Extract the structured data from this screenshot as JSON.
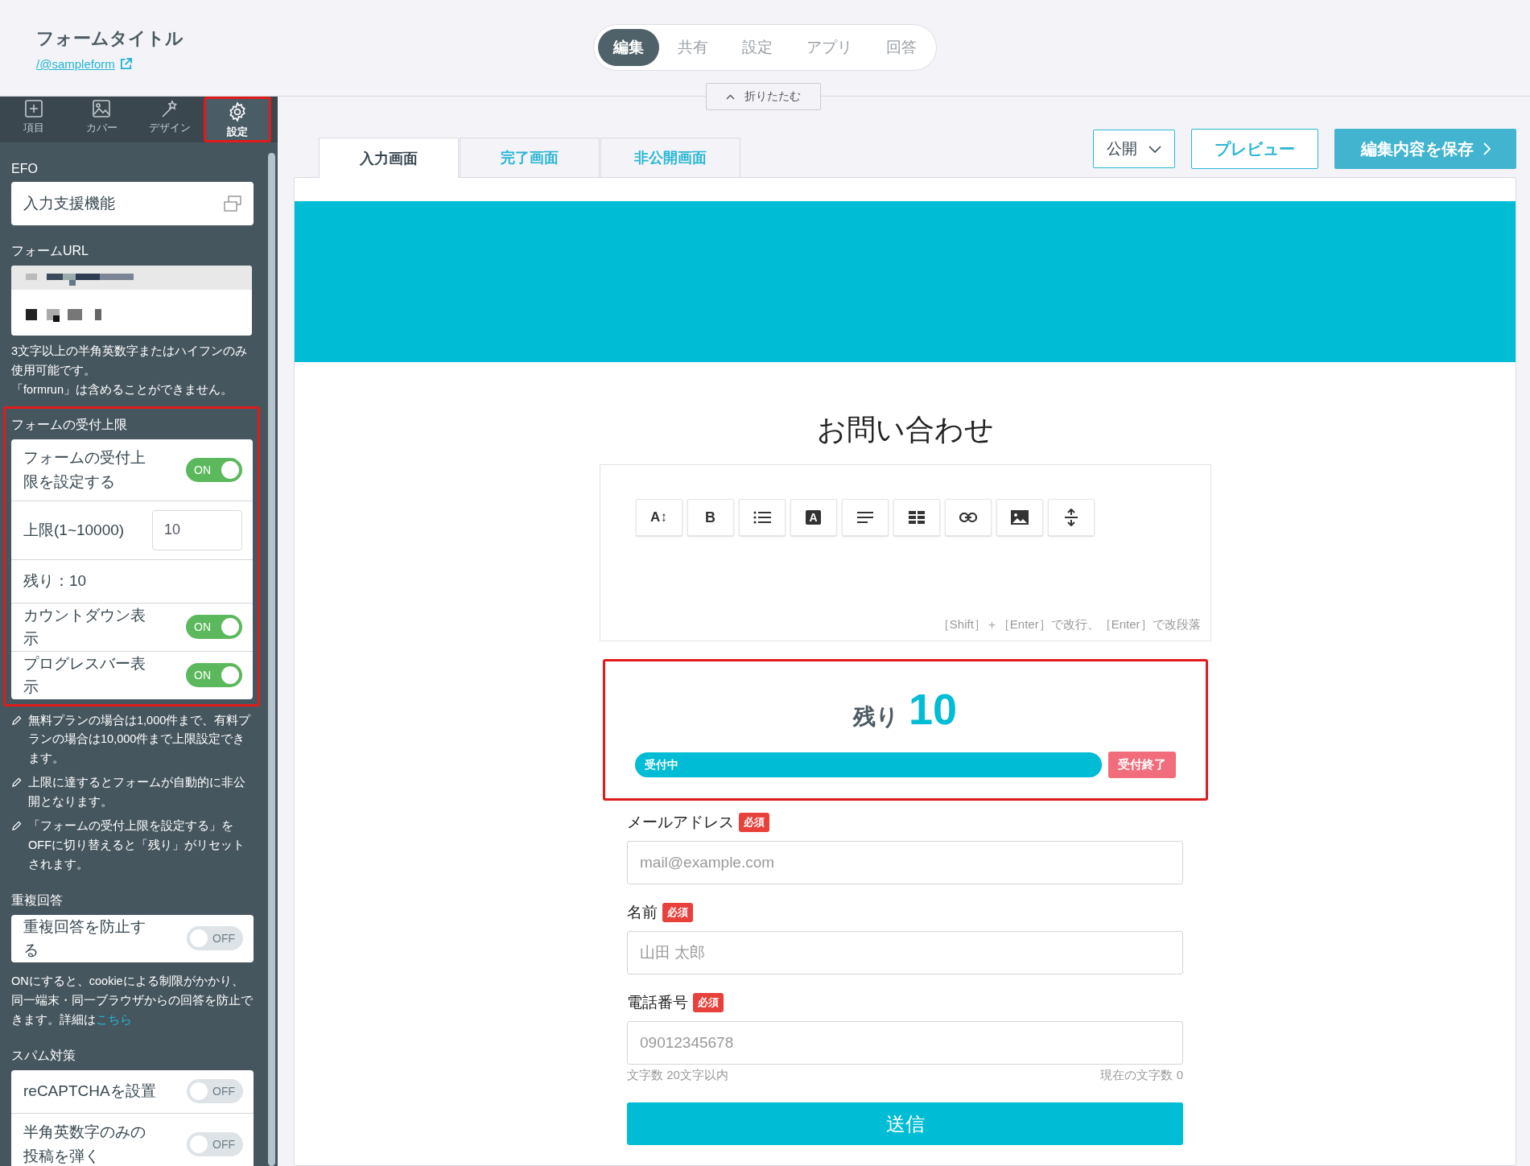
{
  "header": {
    "title": "フォームタイトル",
    "link": "/@sampleform"
  },
  "top_tabs": [
    {
      "label": "編集",
      "selected": true
    },
    {
      "label": "共有",
      "selected": false
    },
    {
      "label": "設定",
      "selected": false
    },
    {
      "label": "アプリ",
      "selected": false
    },
    {
      "label": "回答",
      "selected": false
    }
  ],
  "collapse_button": "折りたたむ",
  "sidebar_nav": [
    {
      "label": "項目",
      "selected": false
    },
    {
      "label": "カバー",
      "selected": false
    },
    {
      "label": "デザイン",
      "selected": false
    },
    {
      "label": "設定",
      "selected": true
    }
  ],
  "sidebar": {
    "efo": {
      "heading": "EFO",
      "item": "入力支援機能"
    },
    "form_url": {
      "heading": "フォームURL",
      "notes": [
        "3文字以上の半角英数字またはハイフンのみ使用可能です。",
        "「formrun」は含めることができません。"
      ]
    },
    "limit": {
      "heading": "フォームの受付上限",
      "rows": [
        {
          "kind": "toggle",
          "label": "フォームの受付上限を設定する",
          "on": true,
          "state_label": "ON"
        },
        {
          "kind": "input",
          "label": "上限(1~10000)",
          "value": "10"
        },
        {
          "kind": "text",
          "label": "残り：10"
        },
        {
          "kind": "toggle",
          "label": "カウントダウン表示",
          "on": true,
          "state_label": "ON"
        },
        {
          "kind": "toggle",
          "label": "プログレスバー表示",
          "on": true,
          "state_label": "ON"
        }
      ],
      "notes": [
        "無料プランの場合は1,000件まで、有料プランの場合は10,000件まで上限設定できます。",
        "上限に達するとフォームが自動的に非公開となります。",
        "「フォームの受付上限を設定する」をOFFに切り替えると「残り」がリセットされます。"
      ]
    },
    "duplicate": {
      "heading": "重複回答",
      "rows": [
        {
          "kind": "toggle",
          "label": "重複回答を防止する",
          "on": false,
          "state_label": "OFF"
        }
      ],
      "note": "ONにすると、cookieによる制限がかかり、同一端末・同一ブラウザからの回答を防止できます。詳細は",
      "note_link": "こちら"
    },
    "spam": {
      "heading": "スパム対策",
      "rows": [
        {
          "kind": "toggle",
          "label": "reCAPTCHAを設置",
          "on": false,
          "state_label": "OFF"
        },
        {
          "kind": "toggle",
          "label": "半角英数字のみの投稿を弾く",
          "on": false,
          "state_label": "OFF"
        }
      ]
    }
  },
  "screen_tabs": [
    {
      "label": "入力画面",
      "selected": true
    },
    {
      "label": "完了画面",
      "selected": false
    },
    {
      "label": "非公開画面",
      "selected": false
    }
  ],
  "actions": {
    "publish": "公開",
    "preview": "プレビュー",
    "save": "編集内容を保存"
  },
  "form": {
    "title": "お問い合わせ",
    "toolbar": [
      {
        "kind": "size",
        "glyph": "A↕"
      },
      {
        "kind": "bold",
        "glyph": "B"
      },
      {
        "kind": "list"
      },
      {
        "kind": "color",
        "glyph": "A"
      },
      {
        "kind": "align"
      },
      {
        "kind": "table"
      },
      {
        "kind": "link"
      },
      {
        "kind": "image"
      },
      {
        "kind": "divider"
      }
    ],
    "editor_hint": "［Shift］＋［Enter］で改行、［Enter］で改段落",
    "counter": {
      "label": "残り",
      "count": "10",
      "level": 1,
      "bar_label": "受付中",
      "end_label": "受付終了"
    },
    "fields": [
      {
        "label": "メールアドレス",
        "required": true,
        "badge": "必須",
        "placeholder": "mail@example.com"
      },
      {
        "label": "名前",
        "required": true,
        "badge": "必須",
        "placeholder": "山田 太郎"
      },
      {
        "label": "電話番号",
        "required": true,
        "badge": "必須",
        "placeholder": "09012345678",
        "help_left": "文字数 20文字以内",
        "help_right": "現在の文字数 0"
      }
    ],
    "submit": "送信"
  }
}
